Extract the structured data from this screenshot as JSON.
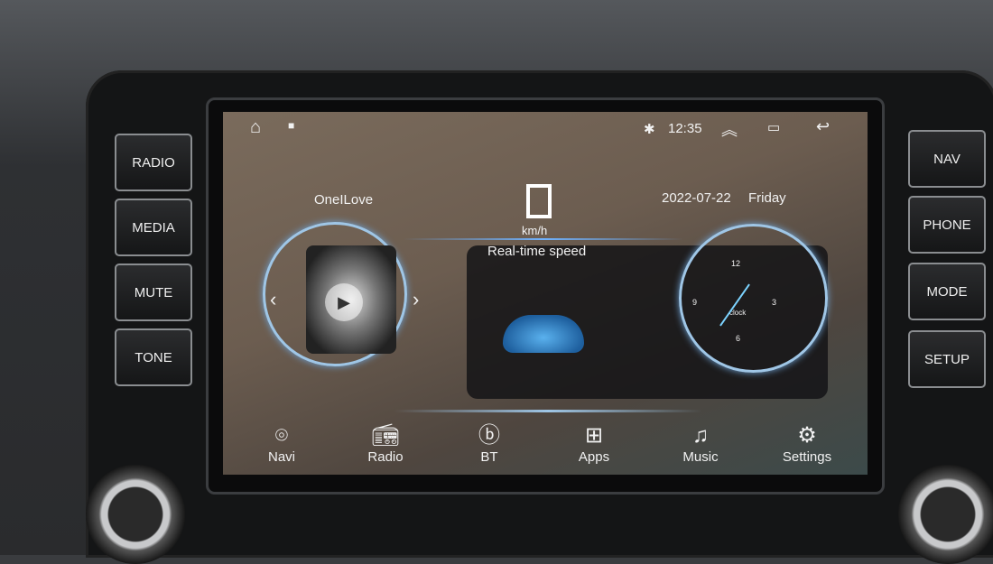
{
  "hardware_buttons": {
    "left": [
      "RADIO",
      "MEDIA",
      "MUTE",
      "TONE"
    ],
    "right": [
      "NAV",
      "PHONE",
      "MODE",
      "SETUP"
    ]
  },
  "status_bar": {
    "time": "12:35",
    "icons": [
      "home-icon",
      "recent-dot-icon",
      "bluetooth-icon",
      "expand-up-icon",
      "windows-icon",
      "back-icon"
    ]
  },
  "music": {
    "title": "OneILove"
  },
  "speed": {
    "value_glyph": "▯",
    "unit": "km/h",
    "label": "Real-time speed"
  },
  "clock": {
    "date": "2022-07-22",
    "day": "Friday",
    "numerals": [
      "12",
      "3",
      "6",
      "9"
    ],
    "brand": "clock"
  },
  "dock": [
    {
      "label": "Navi",
      "icon": "location-pin-icon"
    },
    {
      "label": "Radio",
      "icon": "radio-icon"
    },
    {
      "label": "BT",
      "icon": "bluetooth-icon"
    },
    {
      "label": "Apps",
      "icon": "apps-grid-icon"
    },
    {
      "label": "Music",
      "icon": "music-note-icon"
    },
    {
      "label": "Settings",
      "icon": "gear-icon"
    }
  ],
  "colors": {
    "accent_ring": "#9fc6e6",
    "screen_bg": "#6c5d50"
  }
}
